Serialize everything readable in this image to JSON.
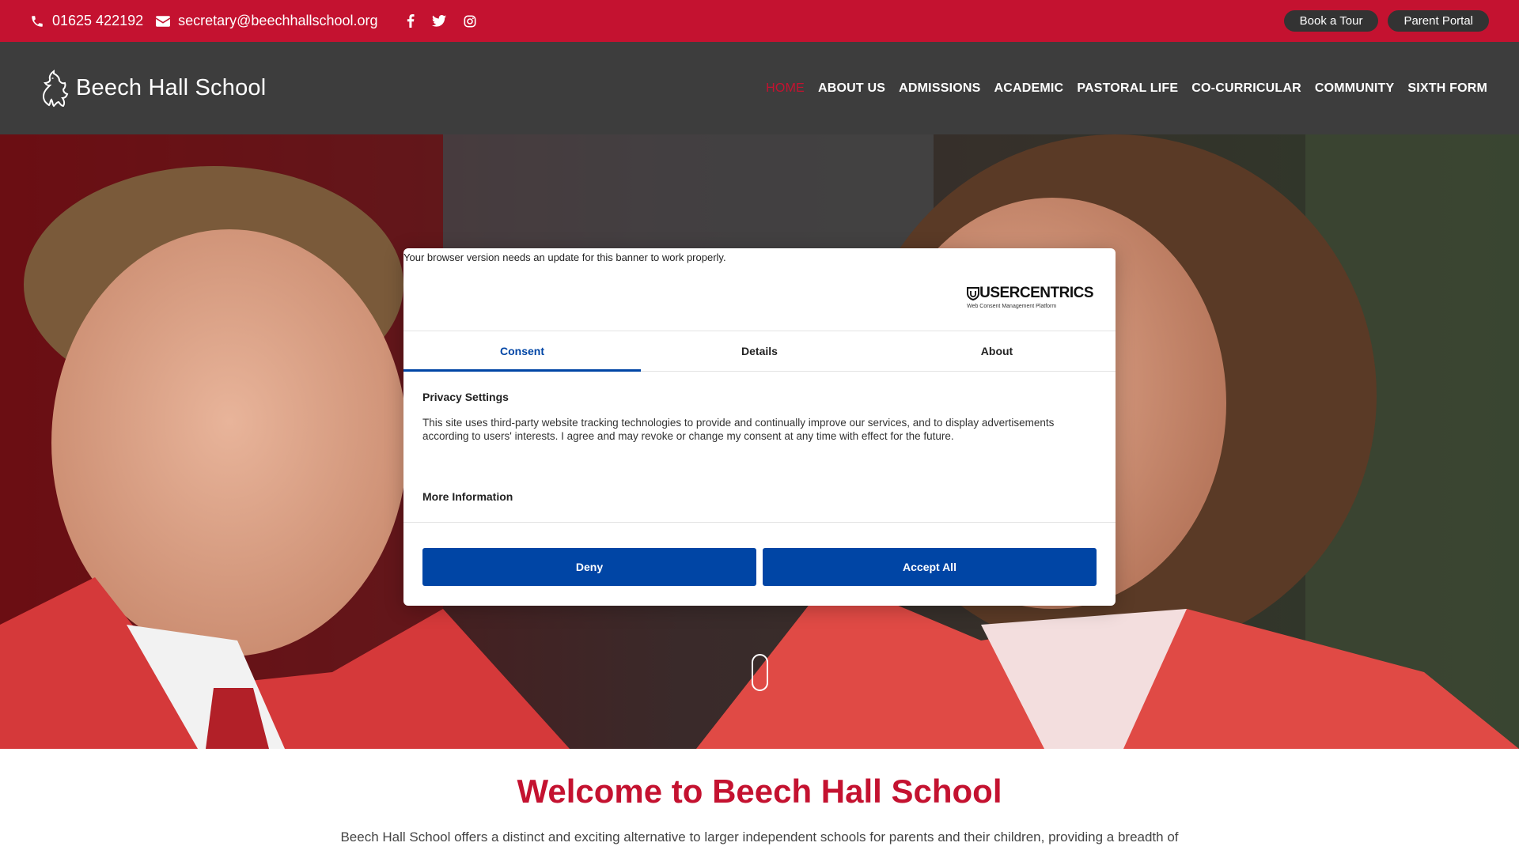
{
  "topbar": {
    "phone": "01625 422192",
    "email": "secretary@beechhallschool.org",
    "social_icons": [
      "facebook-icon",
      "twitter-icon",
      "instagram-icon"
    ],
    "book_tour": "Book a Tour",
    "parent_portal": "Parent Portal",
    "bg_color": "#c41230"
  },
  "header": {
    "logo_text": "Beech Hall School",
    "nav": [
      "HOME",
      "ABOUT US",
      "ADMISSIONS",
      "ACADEMIC",
      "PASTORAL LIFE",
      "CO-CURRICULAR",
      "COMMUNITY",
      "SIXTH FORM"
    ],
    "active_nav": "HOME"
  },
  "consent": {
    "warning": "Your browser version needs an update for this banner to work properly.",
    "brand": "USERCENTRICS",
    "brand_sub": "Web Consent Management Platform",
    "tabs": [
      "Consent",
      "Details",
      "About"
    ],
    "active_tab": "Consent",
    "title": "Privacy Settings",
    "text": "This site uses third-party website tracking technologies to provide and continually improve our services, and to display advertisements according to users' interests. I agree and may revoke or change my consent at any time with effect for the future.",
    "more_info": "More Information",
    "deny": "Deny",
    "accept": "Accept All",
    "accent": "#0045a5"
  },
  "welcome": {
    "title": "Welcome to Beech Hall School",
    "text": "Beech Hall School offers a distinct and exciting alternative to larger independent schools for parents and their children, providing a breadth of"
  }
}
